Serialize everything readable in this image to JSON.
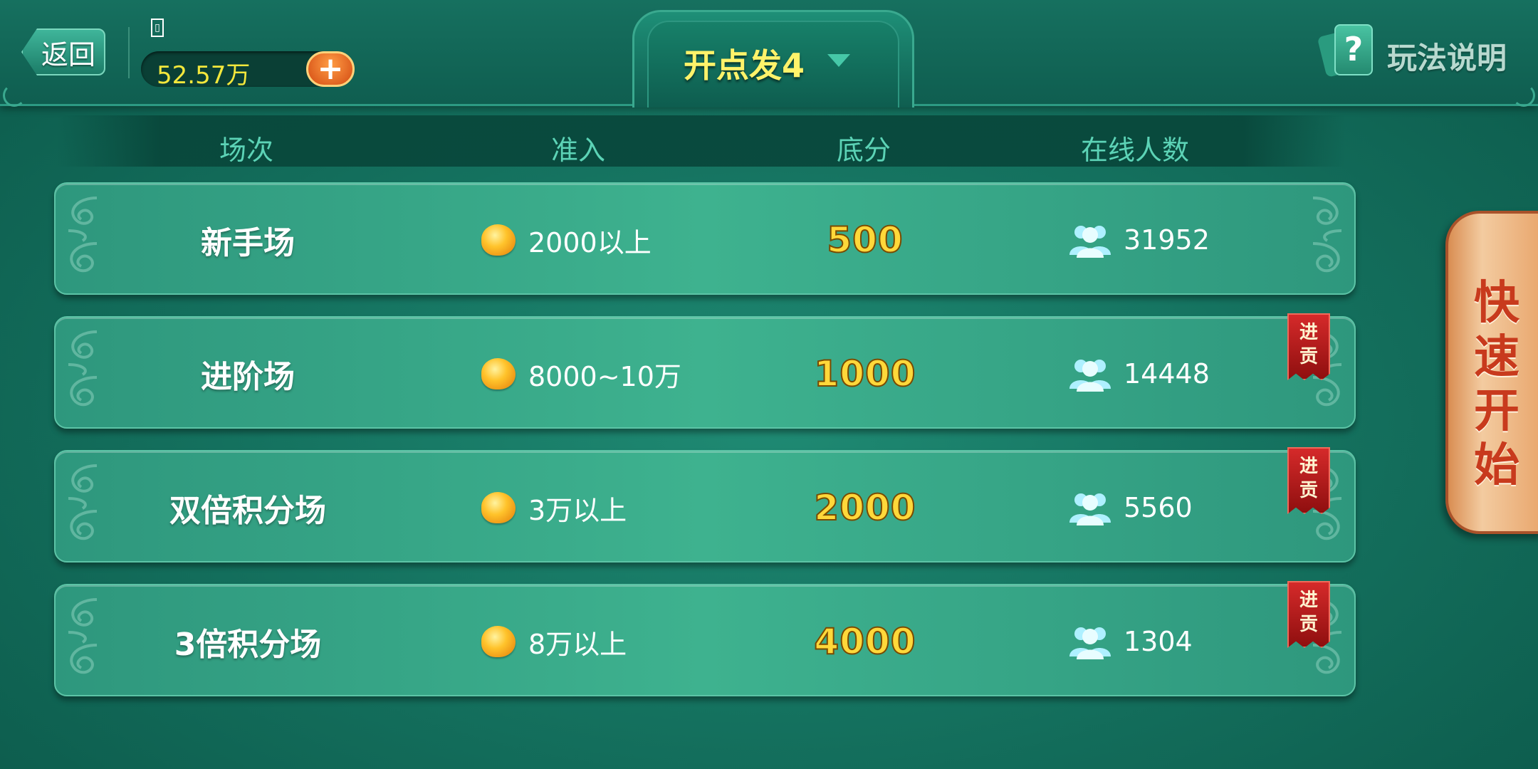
{
  "topbar": {
    "back_label": "返回",
    "user_name": "▯",
    "coins": "52.57万",
    "add_label": "+",
    "mode_title": "开点发4",
    "help_label": "玩法说明",
    "help_icon_glyph": "?"
  },
  "columns": {
    "room": "场次",
    "entry": "准入",
    "base": "底分",
    "online": "在线人数"
  },
  "rooms": [
    {
      "name": "新手场",
      "entry": "2000以上",
      "base": "500",
      "online": "31952",
      "tag": ""
    },
    {
      "name": "进阶场",
      "entry": "8000~10万",
      "base": "1000",
      "online": "14448",
      "tag_top": "进",
      "tag_bottom": "贡"
    },
    {
      "name": "双倍积分场",
      "entry": "3万以上",
      "base": "2000",
      "online": "5560",
      "tag_top": "进",
      "tag_bottom": "贡"
    },
    {
      "name": "3倍积分场",
      "entry": "8万以上",
      "base": "4000",
      "online": "1304",
      "tag_top": "进",
      "tag_bottom": "贡"
    }
  ],
  "quick_start": {
    "chars": [
      "快",
      "速",
      "开",
      "始"
    ]
  },
  "colors": {
    "background": "#157360",
    "row": "#3eb28f",
    "coin_text": "#f3e73c",
    "base_score": "#ffd83a",
    "tribute_tag": "#c41e1e",
    "quick_start_text": "#c83a1d"
  }
}
